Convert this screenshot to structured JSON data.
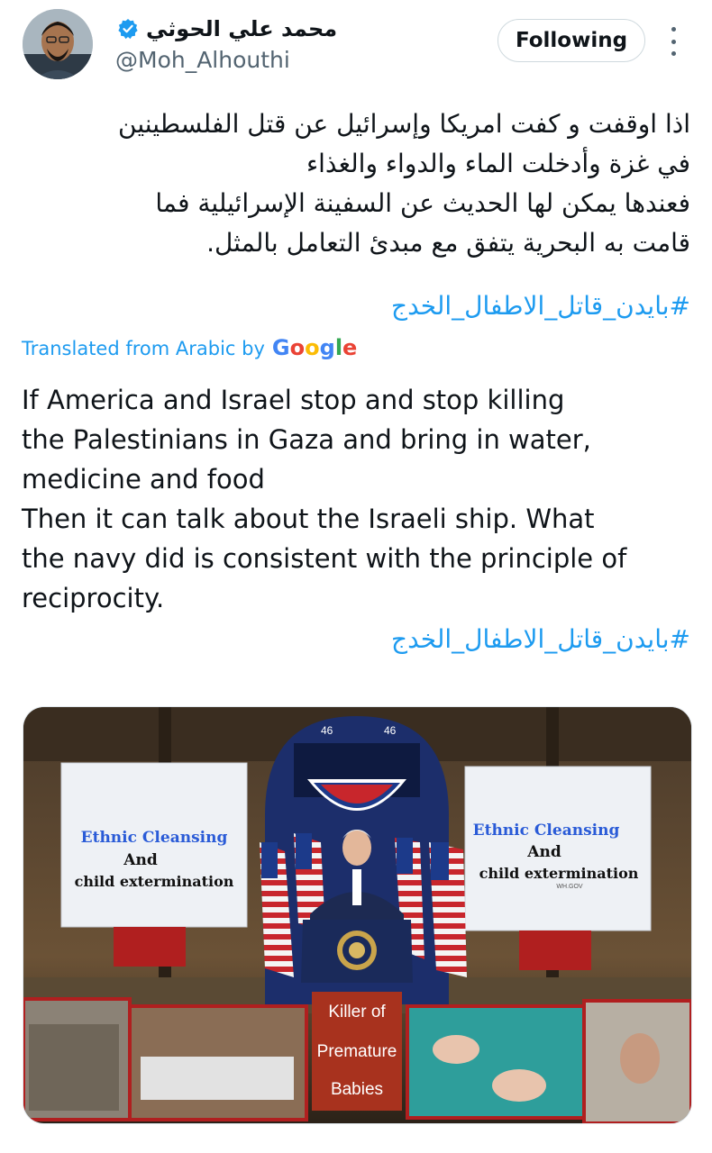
{
  "author": {
    "display_name": "محمد علي الحوثي",
    "handle": "@Moh_Alhouthi",
    "verified": true,
    "avatar_icon": "avatar"
  },
  "follow_button_label": "Following",
  "more_icon": "more-vertical-icon",
  "tweet": {
    "arabic_lines": [
      "اذا اوقفت و كفت امريكا وإسرائيل عن قتل الفلسطينين",
      "في غزة وأدخلت الماء والدواء والغذاء",
      "فعندها يمكن لها الحديث عن السفينة الإسرائيلية فما",
      "قامت به البحرية يتفق مع مبدئ التعامل بالمثل."
    ],
    "arabic_hashtag": "#بايدن_قاتل_الاطفال_الخدج",
    "translated_label": "Translated from Arabic by",
    "translator": "Google",
    "english_lines": [
      "If America and Israel stop and stop killing",
      "the Palestinians in Gaza and bring in water,",
      "medicine and food",
      "Then it can talk about the Israeli ship. What",
      "the navy did is consistent with the principle of",
      "reciprocity."
    ],
    "english_hashtag": "#بايدن_قاتل_الاطفال_الخدج"
  },
  "media": {
    "left_sign": [
      "Ethnic Cleansing",
      "And",
      "child extermination"
    ],
    "right_sign": [
      "Ethnic Cleansing",
      "And",
      "child extermination"
    ],
    "right_sign_small": "WH.GOV",
    "podium_caption": [
      "Killer of",
      "Premature",
      "Babies"
    ],
    "locomotive_number": "46",
    "colors": {
      "accent_blue": "#1d9bf0",
      "sign_blue": "#2a5bd7",
      "caption_red": "#b31b1b"
    }
  }
}
